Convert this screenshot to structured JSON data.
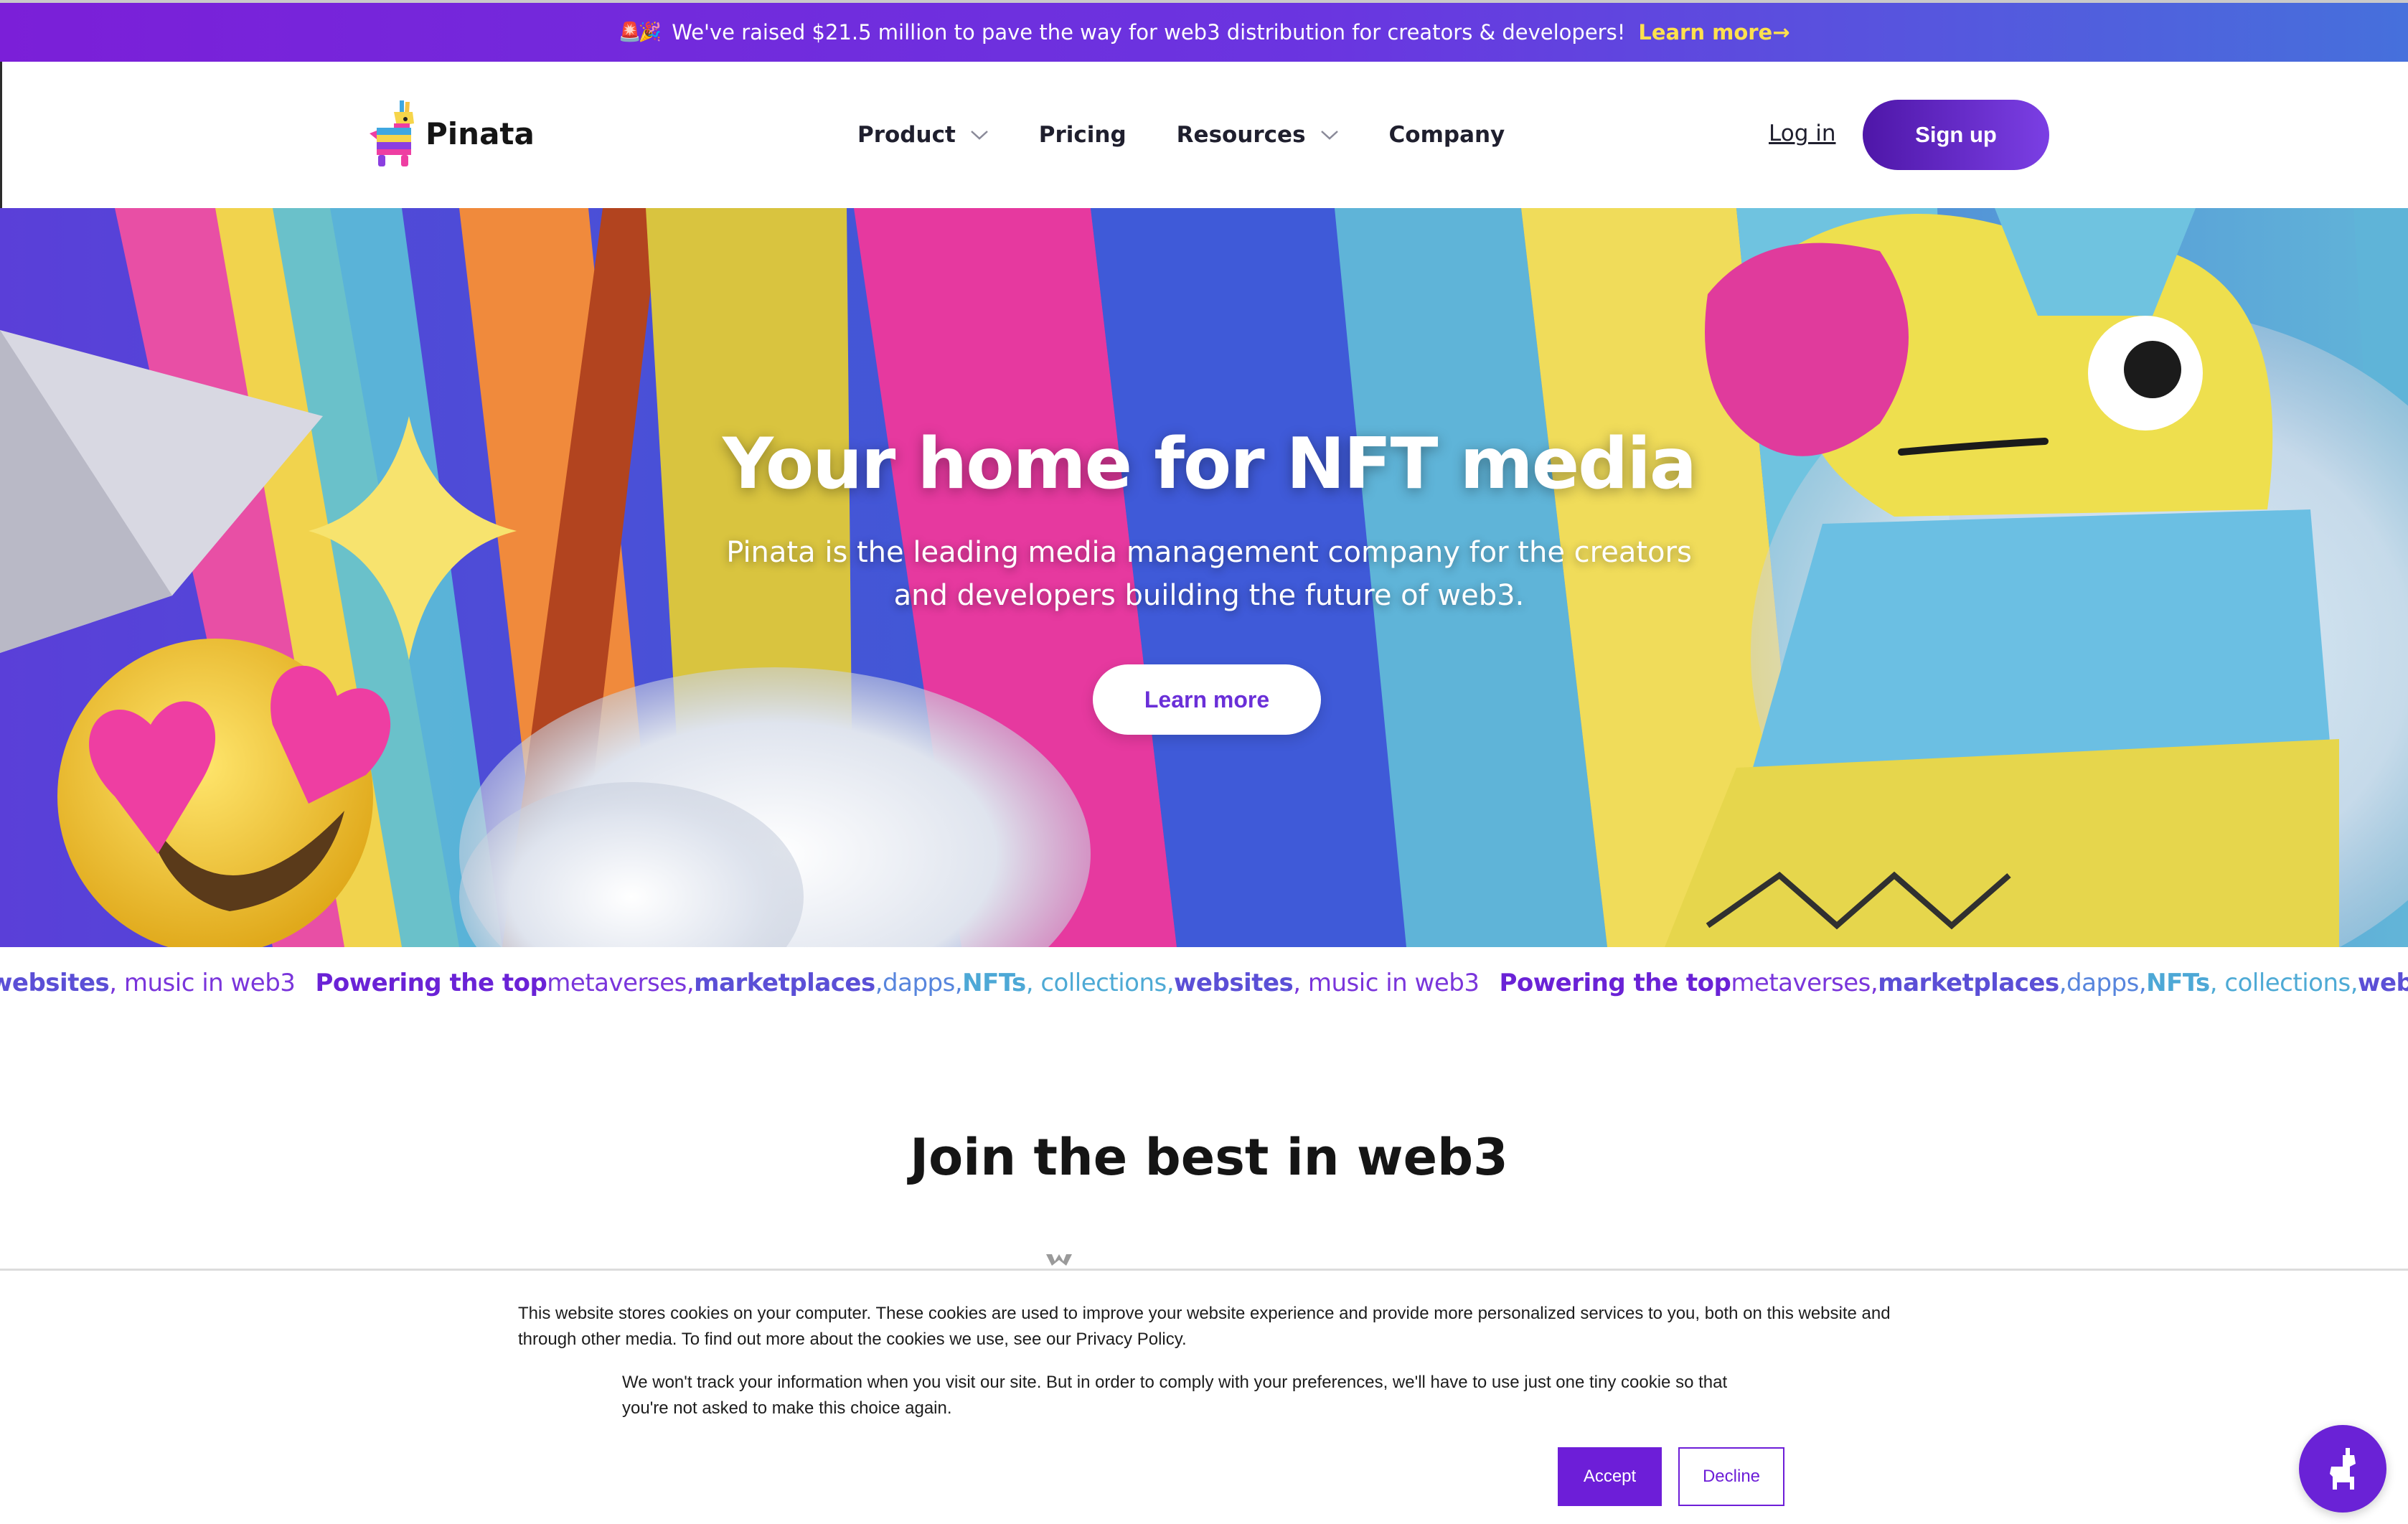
{
  "announcement": {
    "emoji": "🚨🎉",
    "text": "We've raised $21.5 million to pave the way for web3 distribution for creators & developers!",
    "link": "Learn more→",
    "link_color": "#ffe14d"
  },
  "header": {
    "brand": "Pinata",
    "nav": [
      {
        "label": "Product",
        "dropdown": true
      },
      {
        "label": "Pricing",
        "dropdown": false
      },
      {
        "label": "Resources",
        "dropdown": true
      },
      {
        "label": "Company",
        "dropdown": false
      }
    ],
    "login": "Log in",
    "signup": "Sign up"
  },
  "hero": {
    "title": "Your home for NFT media",
    "subtitle": "Pinata is the leading media management company for the creators and developers building the future of web3.",
    "cta": "Learn more"
  },
  "ticker": {
    "lead_fragment": "websites",
    "segments": [
      {
        "text": "Powering the top",
        "style": "t-strong"
      },
      {
        "text": " metaverses, ",
        "style": "t-purple"
      },
      {
        "text": "marketplaces",
        "style": "t-indigo-b"
      },
      {
        "text": ", ",
        "style": "t-blue"
      },
      {
        "text": "dapps, ",
        "style": "t-blue"
      },
      {
        "text": "NFTs",
        "style": "t-teal-b"
      },
      {
        "text": ", collections, ",
        "style": "t-teal"
      },
      {
        "text": "websites",
        "style": "t-indigo-b"
      },
      {
        "text": ", music in web3",
        "style": "t-purple"
      }
    ]
  },
  "join": {
    "title": "Join the best in web3"
  },
  "cookie": {
    "p1": "This website stores cookies on your computer. These cookies are used to improve your website experience and provide more personalized services to you, both on this website and through other media. To find out more about the cookies we use, see our Privacy Policy.",
    "p2": "We won't track your information when you visit our site. But in order to comply with your preferences, we'll have to use just one tiny cookie so that you're not asked to make this choice again.",
    "accept": "Accept",
    "decline": "Decline"
  },
  "colors": {
    "brand_purple": "#6d1ed8",
    "accent_yellow": "#ffe14d"
  },
  "icons": {
    "chat": "llama-icon",
    "dropdown": "chevron-down-icon"
  }
}
